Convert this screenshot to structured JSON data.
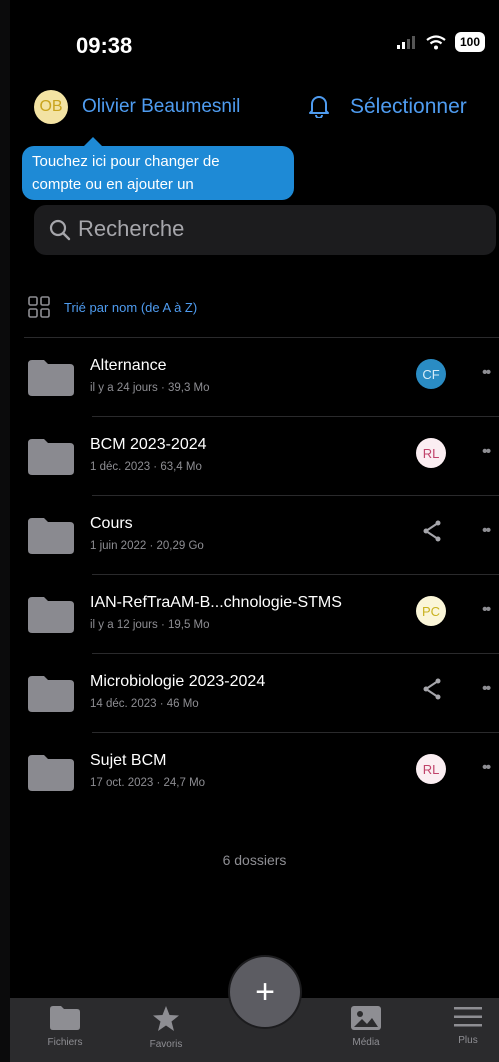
{
  "status_bar": {
    "time": "09:38",
    "battery": "100"
  },
  "header": {
    "avatar_initials": "OB",
    "account_name": "Olivier Beaumesnil",
    "select_label": "Sélectionner"
  },
  "tooltip": {
    "line1": "Touchez ici pour changer de",
    "line2": "compte ou en ajouter un"
  },
  "search": {
    "placeholder": "Recherche"
  },
  "sort": {
    "label": "Trié par nom (de A à Z)"
  },
  "folders": [
    {
      "name": "Alternance",
      "meta": "il y a 24 jours · 39,3 Mo",
      "badge": "CF"
    },
    {
      "name": "BCM 2023-2024",
      "meta": "1 déc. 2023 · 63,4 Mo",
      "badge": "RL"
    },
    {
      "name": "Cours",
      "meta": "1 juin 2022 · 20,29 Go",
      "badge": ""
    },
    {
      "name": "IAN-RefTraAM-B...chnologie-STMS",
      "meta": "il y a 12 jours · 19,5 Mo",
      "badge": "PC"
    },
    {
      "name": "Microbiologie 2023-2024",
      "meta": "14 déc. 2023 · 46 Mo",
      "badge": ""
    },
    {
      "name": "Sujet BCM",
      "meta": "17 oct. 2023 · 24,7 Mo",
      "badge": "RL"
    }
  ],
  "folder_count": "6 dossiers",
  "tabs": {
    "files": "Fichiers",
    "favorites": "Favoris",
    "media": "Média",
    "more": "Plus"
  },
  "fab": {
    "label": "+"
  },
  "colors": {
    "accent": "#4f9cf0",
    "tooltip": "#1e8ad6",
    "badge_cf": "#2a8cc4",
    "badge_rl_text": "#c0436a",
    "badge_pc_text": "#c9b21f"
  }
}
